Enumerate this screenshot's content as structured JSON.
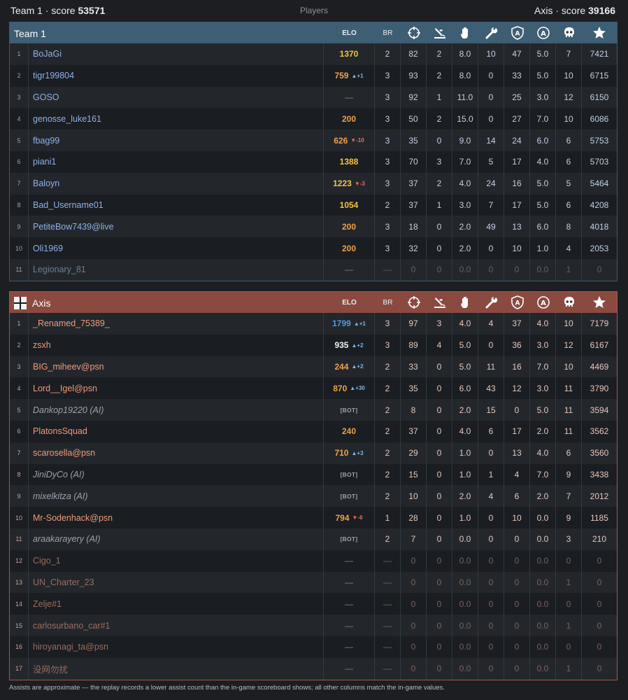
{
  "top": {
    "team1_label": "Team 1 · score",
    "team1_score": "53571",
    "center": "Players",
    "axis_label": "Axis · score",
    "axis_score": "39166"
  },
  "headers": {
    "elo": "ELO",
    "br": "BR"
  },
  "icons": [
    "crosshair-icon",
    "crashed-plane-icon",
    "hand-icon",
    "wrench-icon",
    "shield-a-icon",
    "circle-a-icon",
    "skull-icon",
    "star-icon"
  ],
  "colors": {
    "team1_header": "#3e5e73",
    "axis_header": "#8a4a40",
    "elo_gold": "#f5c242",
    "elo_orange": "#f0a04b",
    "elo_blue": "#4f9be6",
    "delta_up": "#7fb4ee",
    "delta_down": "#ef6b5a"
  },
  "team1": {
    "name": "Team 1",
    "rows": [
      {
        "idx": "1",
        "name": "BoJaGi",
        "elo": "1370",
        "elo_class": "gold",
        "delta": "",
        "br": "2",
        "stats": [
          "82",
          "2",
          "8.0",
          "10",
          "47",
          "5.0",
          "7",
          "7421"
        ]
      },
      {
        "idx": "2",
        "name": "tigr199804",
        "elo": "759",
        "elo_class": "orange",
        "delta": "▲+1",
        "br": "3",
        "stats": [
          "93",
          "2",
          "8.0",
          "0",
          "33",
          "5.0",
          "10",
          "6715"
        ]
      },
      {
        "idx": "3",
        "name": "GOSO",
        "elo": "—",
        "elo_class": "dash",
        "delta": "",
        "br": "3",
        "stats": [
          "92",
          "1",
          "11.0",
          "0",
          "25",
          "3.0",
          "12",
          "6150"
        ]
      },
      {
        "idx": "4",
        "name": "genosse_luke161",
        "elo": "200",
        "elo_class": "orange",
        "delta": "",
        "br": "3",
        "stats": [
          "50",
          "2",
          "15.0",
          "0",
          "27",
          "7.0",
          "10",
          "6086"
        ]
      },
      {
        "idx": "5",
        "name": "fbag99",
        "elo": "626",
        "elo_class": "orange",
        "delta": "▼-10",
        "br": "3",
        "stats": [
          "35",
          "0",
          "9.0",
          "14",
          "24",
          "6.0",
          "6",
          "5753"
        ]
      },
      {
        "idx": "6",
        "name": "piani1",
        "elo": "1388",
        "elo_class": "gold",
        "delta": "",
        "br": "3",
        "stats": [
          "70",
          "3",
          "7.0",
          "5",
          "17",
          "4.0",
          "6",
          "5703"
        ]
      },
      {
        "idx": "7",
        "name": "Baloyn",
        "elo": "1223",
        "elo_class": "gold",
        "delta": "▼-3",
        "br": "3",
        "stats": [
          "37",
          "2",
          "4.0",
          "24",
          "16",
          "5.0",
          "5",
          "5464"
        ]
      },
      {
        "idx": "8",
        "name": "Bad_Username01",
        "elo": "1054",
        "elo_class": "gold",
        "delta": "",
        "br": "2",
        "stats": [
          "37",
          "1",
          "3.0",
          "7",
          "17",
          "5.0",
          "6",
          "4208"
        ]
      },
      {
        "idx": "9",
        "name": "PetiteBow7439@live",
        "elo": "200",
        "elo_class": "orange",
        "delta": "",
        "br": "3",
        "stats": [
          "18",
          "0",
          "2.0",
          "49",
          "13",
          "6.0",
          "8",
          "4018"
        ]
      },
      {
        "idx": "10",
        "name": "Oli1969",
        "elo": "200",
        "elo_class": "orange",
        "delta": "",
        "br": "3",
        "stats": [
          "32",
          "0",
          "2.0",
          "0",
          "10",
          "1.0",
          "4",
          "2053"
        ]
      },
      {
        "idx": "11",
        "name": "Legionary_81",
        "elo": "—",
        "elo_class": "dash",
        "delta": "",
        "br": "—",
        "dim": true,
        "stats": [
          "0",
          "0",
          "0.0",
          "0",
          "0",
          "0.0",
          "1",
          "0"
        ]
      }
    ]
  },
  "axis": {
    "name": "Axis",
    "rows": [
      {
        "idx": "1",
        "name": "_Renamed_75389_",
        "elo": "1799",
        "elo_class": "blue",
        "delta": "▲+1",
        "br": "3",
        "stats": [
          "97",
          "3",
          "4.0",
          "4",
          "37",
          "4.0",
          "10",
          "7179"
        ]
      },
      {
        "idx": "2",
        "name": "zsxh",
        "elo": "935",
        "elo_class": "white",
        "delta": "▲+2",
        "br": "3",
        "stats": [
          "89",
          "4",
          "5.0",
          "0",
          "36",
          "3.0",
          "12",
          "6167"
        ]
      },
      {
        "idx": "3",
        "name": "BIG_miheev@psn",
        "elo": "244",
        "elo_class": "orange",
        "delta": "▲+2",
        "br": "2",
        "stats": [
          "33",
          "0",
          "5.0",
          "11",
          "16",
          "7.0",
          "10",
          "4469"
        ]
      },
      {
        "idx": "4",
        "name": "Lord__Igel@psn",
        "elo": "870",
        "elo_class": "orange",
        "delta": "▲+30",
        "br": "2",
        "stats": [
          "35",
          "0",
          "6.0",
          "43",
          "12",
          "3.0",
          "11",
          "3790"
        ]
      },
      {
        "idx": "5",
        "name": "Dankop19220 (AI)",
        "elo": "[BOT]",
        "elo_class": "bot",
        "delta": "",
        "br": "2",
        "ai": true,
        "stats": [
          "8",
          "0",
          "2.0",
          "15",
          "0",
          "5.0",
          "11",
          "3594"
        ]
      },
      {
        "idx": "6",
        "name": "PlatonsSquad",
        "elo": "240",
        "elo_class": "orange",
        "delta": "",
        "br": "2",
        "stats": [
          "37",
          "0",
          "4.0",
          "6",
          "17",
          "2.0",
          "11",
          "3562"
        ]
      },
      {
        "idx": "7",
        "name": "scarosella@psn",
        "elo": "710",
        "elo_class": "orange",
        "delta": "▲+3",
        "br": "2",
        "stats": [
          "29",
          "0",
          "1.0",
          "0",
          "13",
          "4.0",
          "6",
          "3560"
        ]
      },
      {
        "idx": "8",
        "name": "JiniDyCo (AI)",
        "elo": "[BOT]",
        "elo_class": "bot",
        "delta": "",
        "br": "2",
        "ai": true,
        "stats": [
          "15",
          "0",
          "1.0",
          "1",
          "4",
          "7.0",
          "9",
          "3438"
        ]
      },
      {
        "idx": "9",
        "name": "mixelkitza (AI)",
        "elo": "[BOT]",
        "elo_class": "bot",
        "delta": "",
        "br": "2",
        "ai": true,
        "stats": [
          "10",
          "0",
          "2.0",
          "4",
          "6",
          "2.0",
          "7",
          "2012"
        ]
      },
      {
        "idx": "10",
        "name": "Mr-Sodenhack@psn",
        "elo": "794",
        "elo_class": "orange",
        "delta": "▼-6",
        "br": "1",
        "stats": [
          "28",
          "0",
          "1.0",
          "0",
          "10",
          "0.0",
          "9",
          "1185"
        ]
      },
      {
        "idx": "11",
        "name": "araakarayery (AI)",
        "elo": "[BOT]",
        "elo_class": "bot",
        "delta": "",
        "br": "2",
        "ai": true,
        "stats": [
          "7",
          "0",
          "0.0",
          "0",
          "0",
          "0.0",
          "3",
          "210"
        ]
      },
      {
        "idx": "12",
        "name": "Cigo_1",
        "elo": "—",
        "elo_class": "dash",
        "delta": "",
        "br": "—",
        "dim": true,
        "stats": [
          "0",
          "0",
          "0.0",
          "0",
          "0",
          "0.0",
          "0",
          "0"
        ]
      },
      {
        "idx": "13",
        "name": "UN_Charter_23",
        "elo": "—",
        "elo_class": "dash",
        "delta": "",
        "br": "—",
        "dim": true,
        "stats": [
          "0",
          "0",
          "0.0",
          "0",
          "0",
          "0.0",
          "1",
          "0"
        ]
      },
      {
        "idx": "14",
        "name": "Zelje#1",
        "elo": "—",
        "elo_class": "dash",
        "delta": "",
        "br": "—",
        "dim": true,
        "stats": [
          "0",
          "0",
          "0.0",
          "0",
          "0",
          "0.0",
          "0",
          "0"
        ]
      },
      {
        "idx": "15",
        "name": "carlosurbano_car#1",
        "elo": "—",
        "elo_class": "dash",
        "delta": "",
        "br": "—",
        "dim": true,
        "stats": [
          "0",
          "0",
          "0.0",
          "0",
          "0",
          "0.0",
          "1",
          "0"
        ]
      },
      {
        "idx": "16",
        "name": "hiroyanagi_ta@psn",
        "elo": "—",
        "elo_class": "dash",
        "delta": "",
        "br": "—",
        "dim": true,
        "stats": [
          "0",
          "0",
          "0.0",
          "0",
          "0",
          "0.0",
          "0",
          "0"
        ]
      },
      {
        "idx": "17",
        "name": "没网勿扰",
        "elo": "—",
        "elo_class": "dash",
        "delta": "",
        "br": "—",
        "dim": true,
        "stats": [
          "0",
          "0",
          "0.0",
          "0",
          "0",
          "0.0",
          "1",
          "0"
        ]
      }
    ]
  },
  "footnote": "Assists are approximate — the replay records a lower assist count than the in-game scoreboard shows; all other columns match the in-game values."
}
